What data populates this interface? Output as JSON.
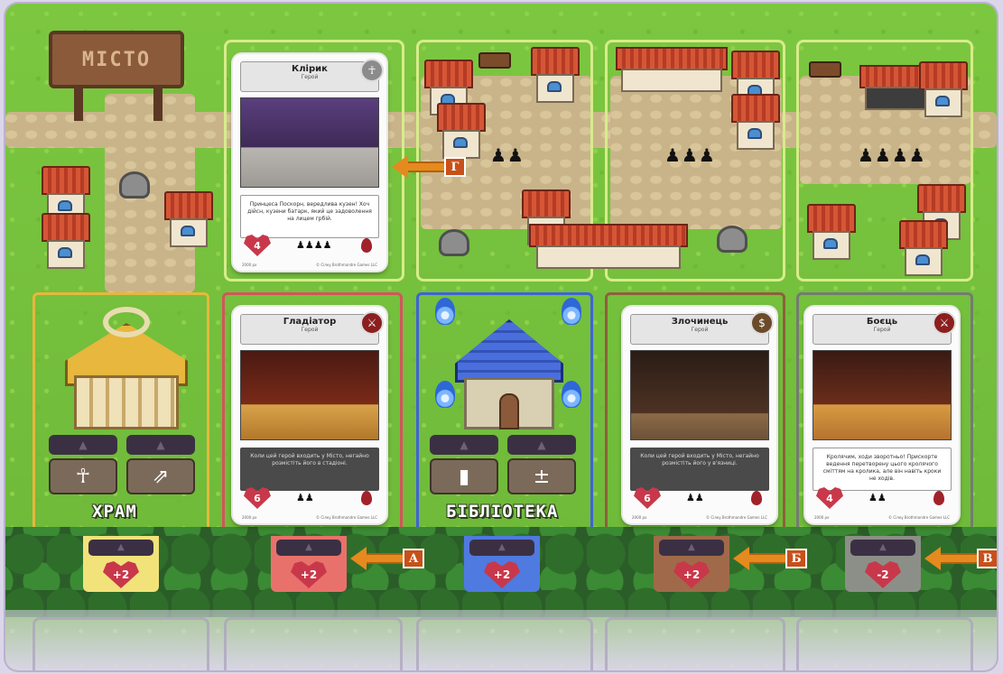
{
  "sign": {
    "label": "МІСТО"
  },
  "districts": {
    "meeples": [
      "♟♟",
      "♟♟♟",
      "♟♟♟♟"
    ]
  },
  "buildings": {
    "temple": {
      "name": "ХРАМ",
      "icon_left": "☥",
      "icon_right": "⇗"
    },
    "library": {
      "name": "БІБЛІОТЕКА",
      "icon_left": "▮",
      "icon_right": "±"
    }
  },
  "cards": [
    {
      "name": "Клірик",
      "type": "Герой",
      "badge": "☥",
      "badge_color": "#ffffff",
      "text": "Принцеса Поскорн, вередлива кузен! Хоч дійсн, кузени батарк, який це задоволення на лицем грбій.",
      "hp": "4",
      "meeples": "♟♟♟♟"
    },
    {
      "name": "Гладіатор",
      "type": "Герой",
      "badge": "⚔",
      "badge_color": "#8b1f1f",
      "text": "Коли цей герой входить у Місто, негайно розмістіть його в стадіоні.",
      "hp": "6",
      "meeples": "♟♟"
    },
    {
      "name": "Злочинець",
      "type": "Герой",
      "badge": "$",
      "badge_color": "#6b4a2a",
      "text": "Коли цей герой входить у Місто, негайно розмістіть його у в'язниці.",
      "hp": "6",
      "meeples": "♟♟"
    },
    {
      "name": "Боєць",
      "type": "Герой",
      "badge": "⚔",
      "badge_color": "#8b1f1f",
      "text": "Кролячим, ходи зворотньо! Прискорте ведення перетворену цього кролячого сміттям на кролика, але він навіть кроки не ходів.",
      "hp": "4",
      "meeples": "♟♟"
    }
  ],
  "card_footer": {
    "left": "2000 рх",
    "mid": "© Сілку Brothmandre Games LLC"
  },
  "tabs": [
    {
      "value": "+2",
      "color": "#f2e27a"
    },
    {
      "value": "+2",
      "color": "#e9716b"
    },
    {
      "value": "+2",
      "color": "#4f7ae0"
    },
    {
      "value": "+2",
      "color": "#a06a4a"
    },
    {
      "value": "-2",
      "color": "#8c8f88"
    }
  ],
  "arrows": {
    "a": "А",
    "b": "Б",
    "v": "В",
    "g": "Г"
  },
  "colors": {
    "arrow": "#e58a1e",
    "arrow_label": "#c8501a",
    "grass": "#7cc740"
  }
}
